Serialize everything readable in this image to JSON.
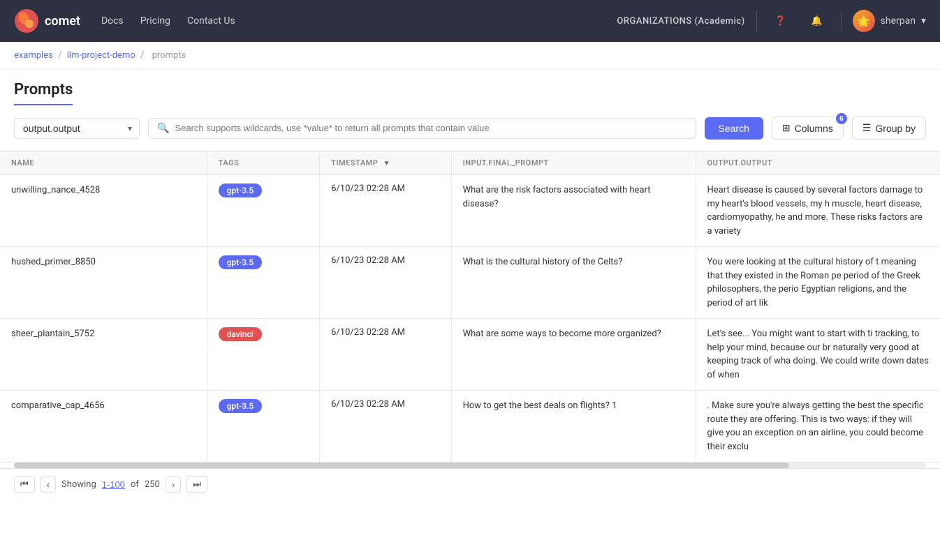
{
  "header": {
    "logo_text": "comet",
    "nav": [
      "Docs",
      "Pricing",
      "Contact Us"
    ],
    "org": "ORGANIZATIONS (Academic)",
    "user": "sherpan"
  },
  "breadcrumb": {
    "parts": [
      "examples",
      "llm-project-demo",
      "prompts"
    ],
    "separator": "/"
  },
  "page": {
    "title": "Prompts"
  },
  "toolbar": {
    "filter_value": "output.output",
    "search_placeholder": "Search supports wildcards, use *value* to return all prompts that contain value",
    "search_label": "Search",
    "columns_label": "Columns",
    "columns_count": "6",
    "groupby_label": "Group by"
  },
  "table": {
    "columns": [
      "NAME",
      "TAGS",
      "TIMESTAMP",
      "INPUT.FINAL_PROMPT",
      "OUTPUT.OUTPUT"
    ],
    "timestamp_sort": "▼",
    "rows": [
      {
        "name": "unwilling_nance_4528",
        "tag": "gpt-3.5",
        "tag_type": "gpt",
        "timestamp": "6/10/23 02:28 AM",
        "input": "What are the risk factors associated with heart disease?",
        "output": "Heart disease is caused by several factors damage to my heart's blood vessels, my h muscle, heart disease, cardiomyopathy, he and more. These risks factors are a variety"
      },
      {
        "name": "hushed_primer_8850",
        "tag": "gpt-3.5",
        "tag_type": "gpt",
        "timestamp": "6/10/23 02:28 AM",
        "input": "What is the cultural history of the Celts?",
        "output": "You were looking at the cultural history of t meaning that they existed in the Roman pe period of the Greek philosophers, the perio Egyptian religions, and the period of art lik"
      },
      {
        "name": "sheer_plantain_5752",
        "tag": "davinci",
        "tag_type": "davinci",
        "timestamp": "6/10/23 02:28 AM",
        "input": "What are some ways to become more organized?",
        "output": "Let's see... You might want to start with ti tracking, to help your mind, because our br naturally very good at keeping track of wha doing. We could write down dates of when"
      },
      {
        "name": "comparative_cap_4656",
        "tag": "gpt-3.5",
        "tag_type": "gpt",
        "timestamp": "6/10/23 02:28 AM",
        "input": "How to get the best deals on flights? 1",
        "output": ". Make sure you're always getting the best the specific route they are offering. This is two ways: if they will give you an exception on an airline, you could become their exclu"
      }
    ]
  },
  "footer": {
    "showing_label": "Showing",
    "range": "1-100",
    "of_label": "of",
    "total": "250"
  }
}
